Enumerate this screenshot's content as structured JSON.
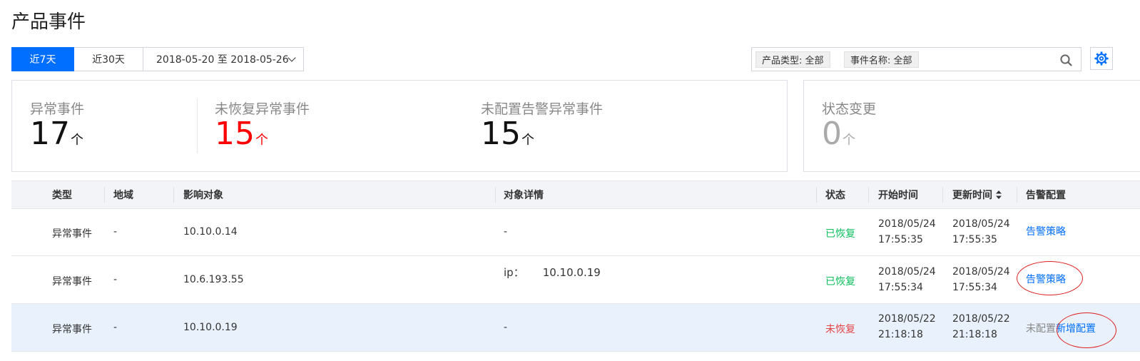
{
  "page": {
    "title": "产品事件"
  },
  "range": {
    "opt7": "近7天",
    "opt30": "近30天",
    "dates": "2018-05-20 至 2018-05-26"
  },
  "filters": {
    "product_type": "产品类型: 全部",
    "event_name": "事件名称: 全部"
  },
  "stats": {
    "abnormal": {
      "label": "异常事件",
      "value": "17",
      "unit": "个"
    },
    "unrecovered": {
      "label": "未恢复异常事件",
      "value": "15",
      "unit": "个"
    },
    "unconfigured": {
      "label": "未配置告警异常事件",
      "value": "15",
      "unit": "个"
    },
    "state_change": {
      "label": "状态变更",
      "value": "0",
      "unit": "个"
    }
  },
  "table": {
    "headers": {
      "type": "类型",
      "region": "地域",
      "target": "影响对象",
      "detail": "对象详情",
      "status": "状态",
      "start": "开始时间",
      "update": "更新时间",
      "alarm": "告警配置"
    },
    "rows": [
      {
        "type": "异常事件",
        "region": "-",
        "target": "10.10.0.14",
        "detail": "-",
        "status": "已恢复",
        "start_date": "2018/05/24",
        "start_time": "17:55:35",
        "update_date": "2018/05/24",
        "update_time": "17:55:35",
        "alarm": "告警策略"
      },
      {
        "type": "异常事件",
        "region": "-",
        "target": "10.6.193.55",
        "detail_key": "ip：",
        "detail_val": "10.10.0.19",
        "status": "已恢复",
        "start_date": "2018/05/24",
        "start_time": "17:55:34",
        "update_date": "2018/05/24",
        "update_time": "17:55:34",
        "alarm": "告警策略"
      },
      {
        "type": "异常事件",
        "region": "-",
        "target": "10.10.0.19",
        "detail": "-",
        "status": "未恢复",
        "start_date": "2018/05/22",
        "start_time": "21:18:18",
        "update_date": "2018/05/22",
        "update_time": "21:18:18",
        "alarm_status": "未配置",
        "alarm": "新增配置"
      }
    ]
  },
  "colors": {
    "accent": "#006eff",
    "recovered": "#0abf5b",
    "unrecovered": "#e54545",
    "highlight_row": "#e8f1fc",
    "annotation": "#e02020"
  }
}
